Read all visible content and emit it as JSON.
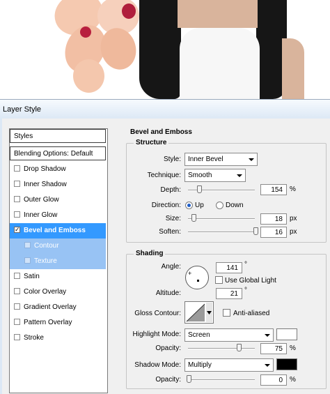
{
  "window": {
    "title": "Layer Style"
  },
  "styles_list": {
    "header": "Styles",
    "blending_options": "Blending Options: Default",
    "items": [
      {
        "label": "Drop Shadow",
        "checked": false
      },
      {
        "label": "Inner Shadow",
        "checked": false
      },
      {
        "label": "Outer Glow",
        "checked": false
      },
      {
        "label": "Inner Glow",
        "checked": false
      },
      {
        "label": "Bevel and Emboss",
        "checked": true,
        "selected": true
      },
      {
        "label": "Contour",
        "checked": false,
        "sub": true
      },
      {
        "label": "Texture",
        "checked": false,
        "sub": true
      },
      {
        "label": "Satin",
        "checked": false
      },
      {
        "label": "Color Overlay",
        "checked": false
      },
      {
        "label": "Gradient Overlay",
        "checked": false
      },
      {
        "label": "Pattern Overlay",
        "checked": false
      },
      {
        "label": "Stroke",
        "checked": false
      }
    ],
    "check_mark": "✓"
  },
  "bevel": {
    "title": "Bevel and Emboss",
    "structure": {
      "title": "Structure",
      "style_label": "Style:",
      "style_value": "Inner Bevel",
      "technique_label": "Technique:",
      "technique_value": "Smooth",
      "depth_label": "Depth:",
      "depth_value": "154",
      "depth_unit": "%",
      "depth_level": 0.154,
      "direction_label": "Direction:",
      "direction_up": "Up",
      "direction_down": "Down",
      "direction_selected": "Up",
      "size_label": "Size:",
      "size_value": "18",
      "size_unit": "px",
      "size_level": 0.072,
      "soften_label": "Soften:",
      "soften_value": "16",
      "soften_unit": "px",
      "soften_level": 1.0
    },
    "shading": {
      "title": "Shading",
      "angle_label": "Angle:",
      "angle_value": "141",
      "angle_unit": "°",
      "use_global_light_label": "Use Global Light",
      "use_global_light": false,
      "altitude_label": "Altitude:",
      "altitude_value": "21",
      "altitude_unit": "°",
      "gloss_contour_label": "Gloss Contour:",
      "anti_aliased_label": "Anti-aliased",
      "anti_aliased": false,
      "highlight_mode_label": "Highlight Mode:",
      "highlight_mode_value": "Screen",
      "highlight_color": "#ffffff",
      "highlight_opacity_label": "Opacity:",
      "highlight_opacity_value": "75",
      "highlight_opacity_unit": "%",
      "highlight_opacity_level": 0.75,
      "shadow_mode_label": "Shadow Mode:",
      "shadow_mode_value": "Multiply",
      "shadow_color": "#000000",
      "shadow_opacity_label": "Opacity:",
      "shadow_opacity_value": "0",
      "shadow_opacity_unit": "%",
      "shadow_opacity_level": 0.0
    }
  },
  "colors": {
    "selection": "#3399ff",
    "sub_selection": "#98c3f4"
  }
}
